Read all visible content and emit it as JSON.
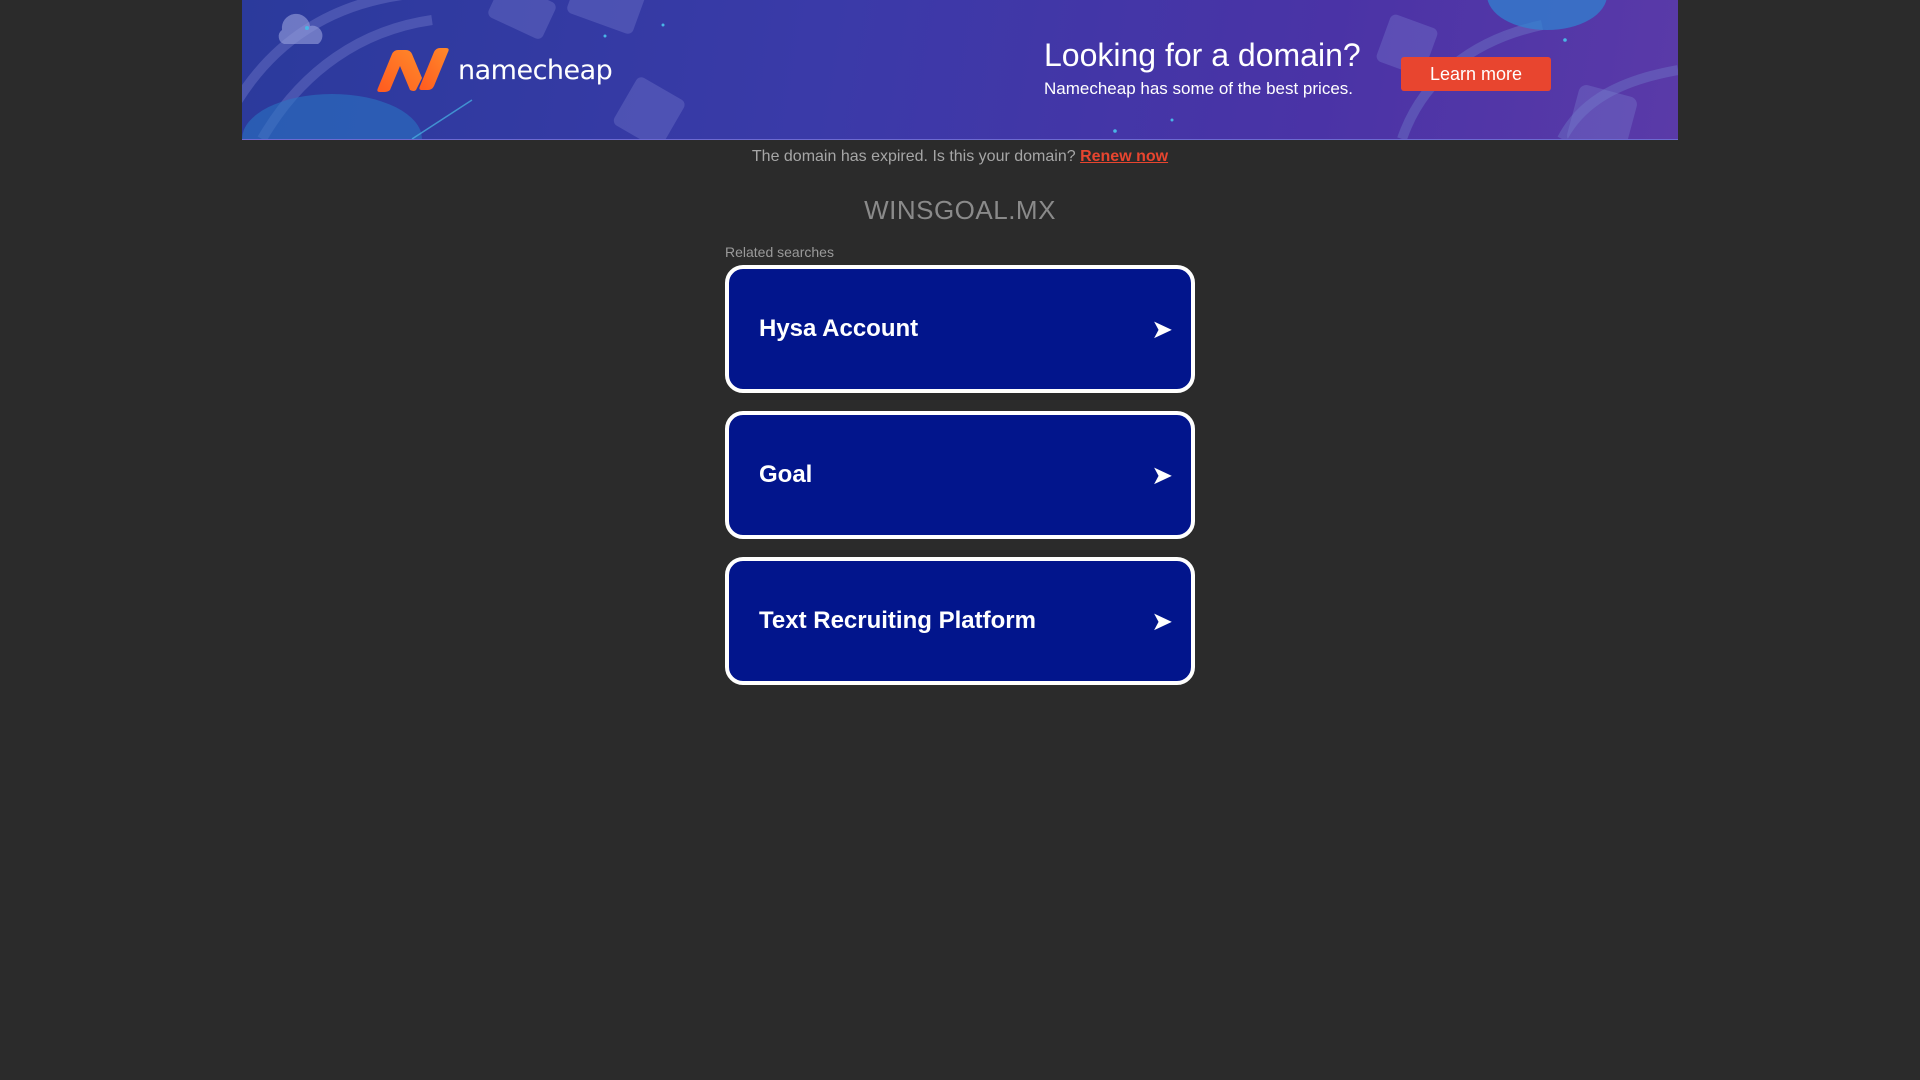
{
  "banner": {
    "logo_text": "namecheap",
    "promo_title": "Looking for a domain?",
    "promo_subtitle": "Namecheap has some of the best prices.",
    "cta_label": "Learn more",
    "accent_color": "#e8452f",
    "background_color": "#3a3aa8"
  },
  "notice": {
    "text": "The domain has expired. Is this your domain?",
    "link_label": "Renew now"
  },
  "domain_name": "WINSGOAL.MX",
  "related": {
    "heading": "Related searches",
    "items": [
      {
        "label": "Hysa Account",
        "icon": "arrow-right-icon"
      },
      {
        "label": "Goal",
        "icon": "arrow-right-icon"
      },
      {
        "label": "Text Recruiting Platform",
        "icon": "arrow-right-icon"
      }
    ],
    "item_color": "#02158c"
  },
  "page_background": "#2b2b2b"
}
